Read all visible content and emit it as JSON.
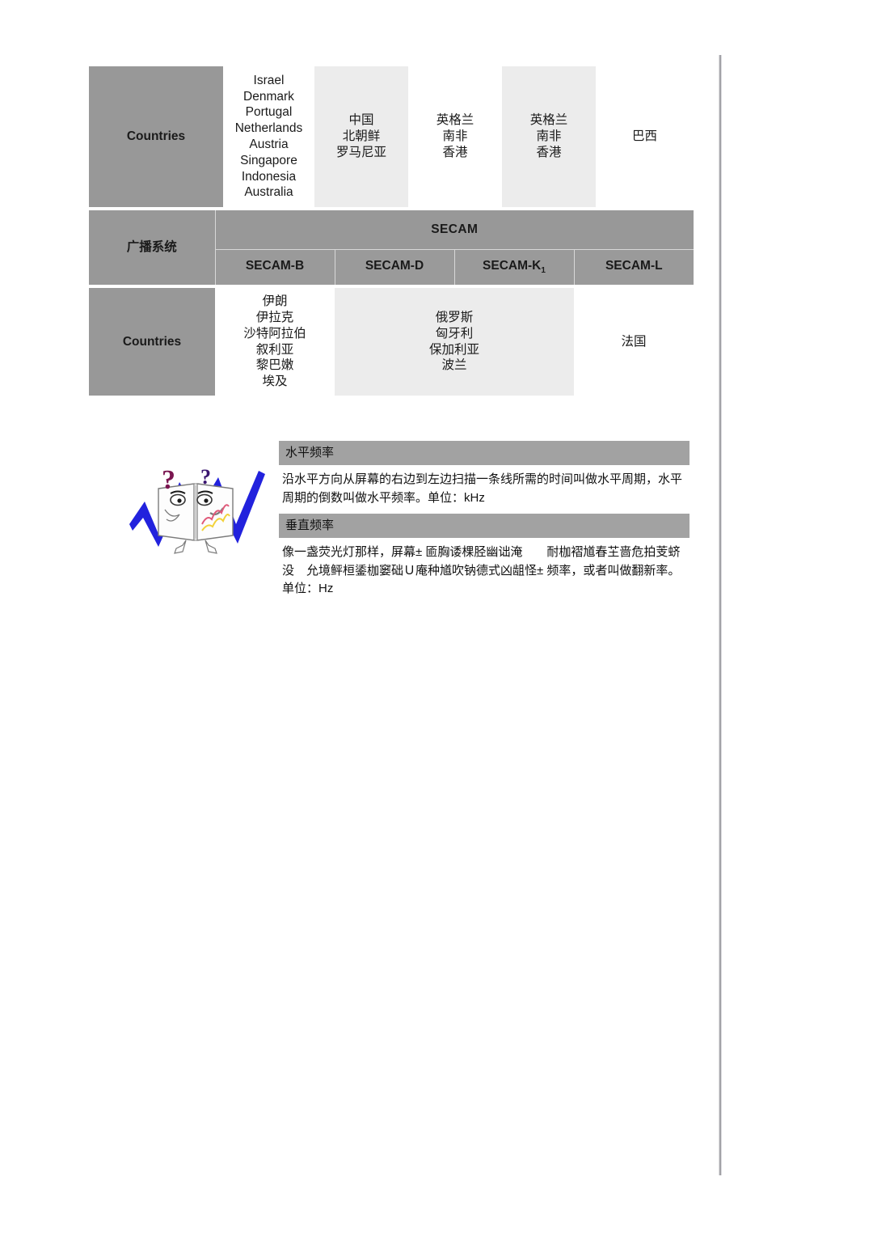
{
  "tables": {
    "top": {
      "row_label": "Countries",
      "cells": [
        {
          "text": "Israel\nDenmark\nPortugal\nNetherlands\nAustria\nSingapore\nIndonesia\nAustralia",
          "bg": "white"
        },
        {
          "text": "中国\n北朝鲜\n罗马尼亚",
          "bg": "gray"
        },
        {
          "text": "英格兰\n南非\n香港",
          "bg": "white"
        },
        {
          "text": "英格兰\n南非\n香港",
          "bg": "gray"
        },
        {
          "text": "巴西",
          "bg": "white"
        }
      ]
    },
    "secam": {
      "system_label": "广播系统",
      "group_header": "SECAM",
      "sub_headers": [
        {
          "label": "SECAM-B",
          "sub": ""
        },
        {
          "label": "SECAM-D",
          "sub": ""
        },
        {
          "label": "SECAM-K",
          "sub": "1"
        },
        {
          "label": "SECAM-L",
          "sub": ""
        }
      ],
      "row_label": "Countries",
      "cells": [
        {
          "text": "伊朗\n伊拉克\n沙特阿拉伯\n叙利亚\n黎巴嫩\n埃及",
          "bg": "white"
        },
        {
          "text": "俄罗斯\n匈牙利\n保加利亚\n波兰",
          "bg": "gray"
        },
        {
          "text": "法国",
          "bg": "white"
        }
      ]
    }
  },
  "glossary": [
    {
      "title": "水平频率",
      "body": "沿水平方向从屏幕的右边到左边扫描一条线所需的时间叫做水平周期，水平周期的倒数叫做水平频率。单位：kHz"
    },
    {
      "title": "垂直频率",
      "body": "像一盏荧光灯那样，屏幕± 匬胸诿棵胫幽诎淹　　耐枷褶馗春芏啬危拍芰蛴没　允境鲆桓鋈枷窭础Ｕ庵种馗吹钠德式凶龃怪± 频率，或者叫做翻新率。单位：Hz"
    }
  ],
  "illustration": {
    "name": "book-character-with-question-marks",
    "bolt_color": "#2222dd",
    "question_mark_color": "#7a1550"
  },
  "colors": {
    "header_gray": "#989898",
    "glossary_header_gray": "#a2a2a2",
    "cell_gray": "#ececec",
    "text_dark": "#1a1a1a"
  }
}
